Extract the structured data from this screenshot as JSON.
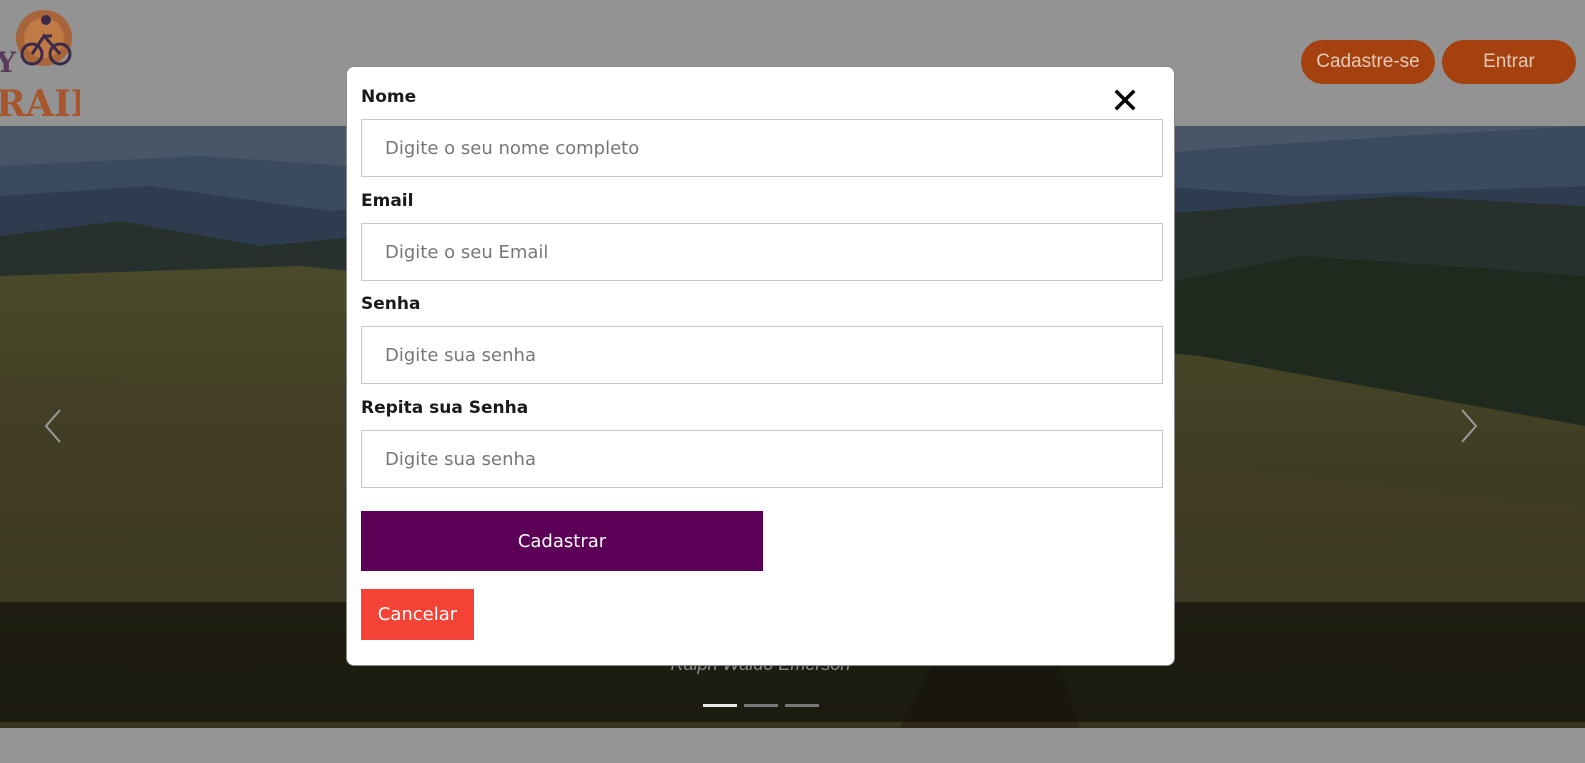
{
  "header": {
    "signup_label": "Cadastre-se",
    "login_label": "Entrar",
    "brand_color": "#a5410e"
  },
  "carousel": {
    "caption_author": "Ralph Waldo Emerson",
    "slide_count": 3,
    "active_slide": 1
  },
  "modal": {
    "fields": [
      {
        "label": "Nome",
        "placeholder": "Digite o seu nome completo",
        "value": ""
      },
      {
        "label": "Email",
        "placeholder": "Digite o seu Email",
        "value": ""
      },
      {
        "label": "Senha",
        "placeholder": "Digite sua senha",
        "value": ""
      },
      {
        "label": "Repita sua Senha",
        "placeholder": "Digite sua senha",
        "value": ""
      }
    ],
    "submit_label": "Cadastrar",
    "cancel_label": "Cancelar",
    "submit_color": "#5c0057",
    "cancel_color": "#f44336"
  }
}
